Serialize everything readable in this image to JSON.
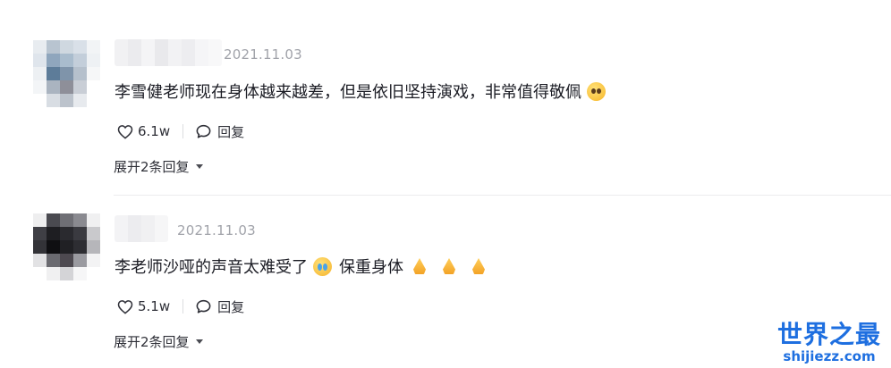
{
  "comments": [
    {
      "date": "2021.11.03",
      "text": "李雪健老师现在身体越来越差，但是依旧坚持演戏，非常值得敬佩",
      "emoji": "pleading-face-emoji",
      "likes": "6.1w",
      "reply_label": "回复",
      "expand_label": "展开2条回复"
    },
    {
      "date": "2021.11.03",
      "text": "李老师沙哑的声音太难受了",
      "emoji": "crying-face-emoji",
      "text_after": "保重身体",
      "trailing_emojis": [
        "folded-hands-emoji",
        "folded-hands-emoji",
        "folded-hands-emoji"
      ],
      "likes": "5.1w",
      "reply_label": "回复",
      "expand_label": "展开2条回复"
    }
  ],
  "watermark": {
    "title": "世界之最",
    "url": "shijiezz.com"
  },
  "colors": {
    "date": "#a1a3aa",
    "text": "#1b1c24",
    "action": "#2f3038",
    "watermark": "#1e6fe0"
  }
}
